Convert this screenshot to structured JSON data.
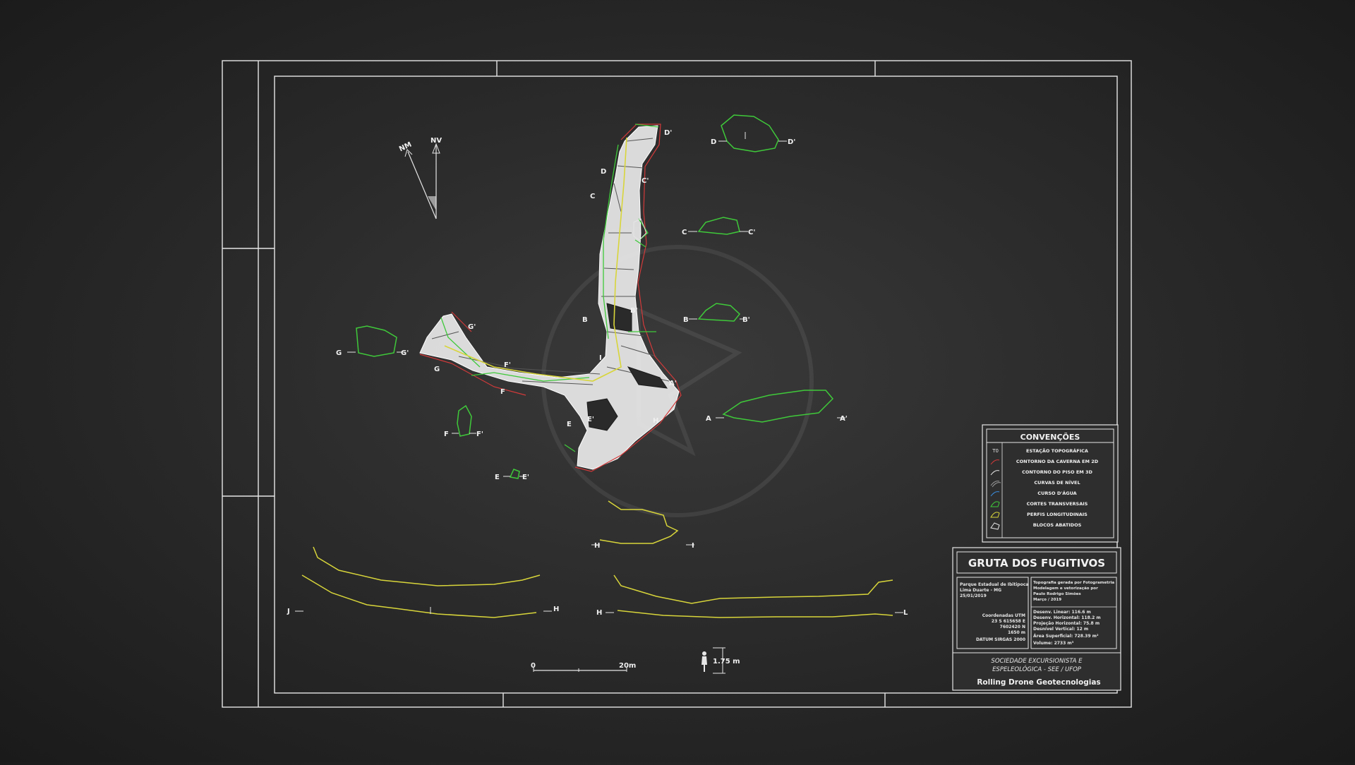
{
  "colors": {
    "frame": "#e6e6e6",
    "green": "#3fc93a",
    "yellow": "#d8d53a",
    "red": "#d23a3a",
    "background": "#2b2b2b"
  },
  "north": {
    "magnetic": "NM",
    "true": "NV"
  },
  "plan_labels": {
    "D": "D",
    "D_prime": "D'",
    "C": "C",
    "C_prime": "C'",
    "B": "B",
    "B_prime": "B'",
    "A_prime": "A'",
    "G": "G",
    "G_prime": "G'",
    "F": "F",
    "F_prime": "F'",
    "E": "E",
    "E_prime": "E'",
    "H": "H",
    "I": "I"
  },
  "section_labels": {
    "d_left": "D",
    "d_right": "D'",
    "c_left": "C",
    "c_right": "C'",
    "b_left": "B",
    "b_right": "B'",
    "a_left": "A",
    "a_right": "A'",
    "g_left": "G",
    "g_right": "G'",
    "f_left": "F",
    "f_right": "F'",
    "e_left": "E",
    "e_right": "E'",
    "h_left": "H",
    "i_right": "I",
    "j_left": "J",
    "jh_right": "H",
    "hl_left": "H",
    "l_right": "L"
  },
  "scale_bar": {
    "zero": "0",
    "length": "20m"
  },
  "human_scale": "1.75 m",
  "legend": {
    "title": "CONVENÇÕES",
    "items": [
      {
        "symbol": "T0",
        "label": "ESTAÇÃO TOPOGRÁFICA"
      },
      {
        "symbol": "",
        "label": "CONTORNO DA CAVERNA EM 2D"
      },
      {
        "symbol": "",
        "label": "CONTORNO DO PISO EM 3D"
      },
      {
        "symbol": "",
        "label": "CURVAS DE NÍVEL"
      },
      {
        "symbol": "",
        "label": "CURSO D'ÁGUA"
      },
      {
        "symbol": "",
        "label": "CORTES TRANSVERSAIS"
      },
      {
        "symbol": "",
        "label": "PERFIS LONGITUDINAIS"
      },
      {
        "symbol": "",
        "label": "BLOCOS ABATIDOS"
      }
    ]
  },
  "title_block": {
    "title": "GRUTA DOS FUGITIVOS",
    "location": [
      "Parque Estadual de Ibitipoca",
      "Lima Duarte - MG",
      "25/01/2019"
    ],
    "coords": [
      "Coordenadas UTM",
      "23 S 615658 E",
      "7602420 N",
      "1650 m",
      "DATUM SIRGAS 2000"
    ],
    "credits": [
      "Topografia gerada por Fotogrametria",
      "Modelagem e vetorização por",
      "Paulo Rodrigo Simões",
      "Março / 2019"
    ],
    "stats": [
      "Desenv. Linear: 116.6 m",
      "Desenv. Horizontal: 118.2 m",
      "Projeção Horizontal: 75.8 m",
      "Desnível Vertical: 12 m",
      "Área Superficial: 728.39 m²",
      "Volume: 2733 m³"
    ],
    "org": [
      "SOCIEDADE EXCURSIONISTA E",
      "ESPELEOLÓGICA - SEE / UFOP"
    ],
    "company": "Rolling Drone Geotecnologias"
  }
}
